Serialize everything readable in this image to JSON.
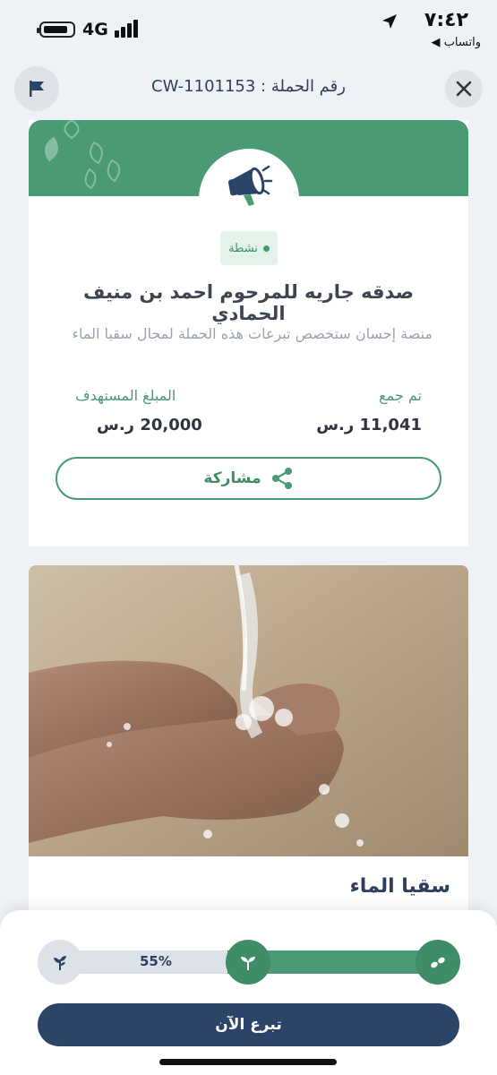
{
  "status_bar": {
    "network": "4G",
    "time": "٧:٤٢",
    "back_app": "◀ واتساب"
  },
  "header": {
    "campaign_number": "رقم الحملة : CW-1101153"
  },
  "campaign": {
    "status_badge": "نشطة",
    "title": "صدقه جاريه للمرحوم احمد بن منيف الحمادي",
    "description": "منصة إحسان ستخصص تبرعات هذه الحملة لمجال سقيا الماء",
    "collected_label": "تم جمع",
    "collected_value": "11,041 ر.س",
    "target_label": "المبلغ المستهدف",
    "target_value": "20,000 ر.س",
    "share_label": "مشاركة"
  },
  "category": {
    "title": "سقيا الماء"
  },
  "footer": {
    "progress_percent": 55,
    "progress_label": "55%",
    "donate_label": "تبرع الآن"
  },
  "colors": {
    "green": "#4a9a74",
    "navy": "#2c4468"
  },
  "icons": [
    "flag-icon",
    "close-icon",
    "megaphone-icon",
    "share-icon",
    "seedling-icon",
    "sprout-icon",
    "tree-icon"
  ]
}
